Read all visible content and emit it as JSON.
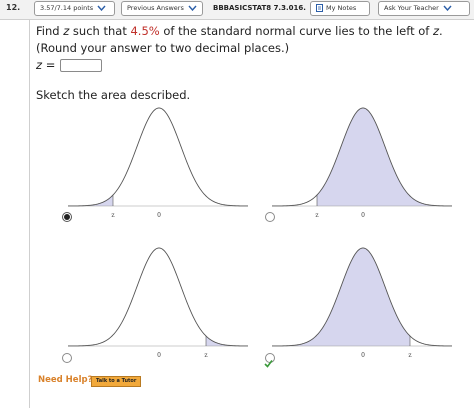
{
  "header": {
    "question_number": "12.",
    "points": "3.57/7.14 points",
    "previous_answers": "Previous Answers",
    "question_id": "BBBASICSTAT8 7.3.016.",
    "my_notes": "My Notes",
    "ask_teacher": "Ask Your Teacher"
  },
  "question": {
    "text_before": "Find ",
    "var": "z",
    "text_mid": " such that ",
    "percent": "4.5%",
    "text_after": " of the standard normal curve lies to the left of ",
    "var_end": "z",
    "text_end": ".",
    "round_note": "(Round your answer to two decimal places.)",
    "z_label": "z",
    "z_equals": " =",
    "z_value": ""
  },
  "sketch": {
    "label": "Sketch the area described."
  },
  "options": [
    {
      "id": "left-tail",
      "selected": true,
      "tick_z": "z",
      "tick_0": "0"
    },
    {
      "id": "left-large",
      "selected": false,
      "tick_z": "z",
      "tick_0": "0"
    },
    {
      "id": "right-tail",
      "selected": false,
      "tick_0": "0",
      "tick_z": "z"
    },
    {
      "id": "left-of-right-z",
      "selected": false,
      "tick_0": "0",
      "tick_z": "z"
    }
  ],
  "colors": {
    "shade": "#d6d6ee",
    "curve": "#555555",
    "accent_red": "#c0302a",
    "help_orange": "#d9822b",
    "check_green": "#3a9a3a"
  },
  "help": {
    "need_help": "Need Help?",
    "talk_to_tutor": "Talk to a Tutor"
  }
}
